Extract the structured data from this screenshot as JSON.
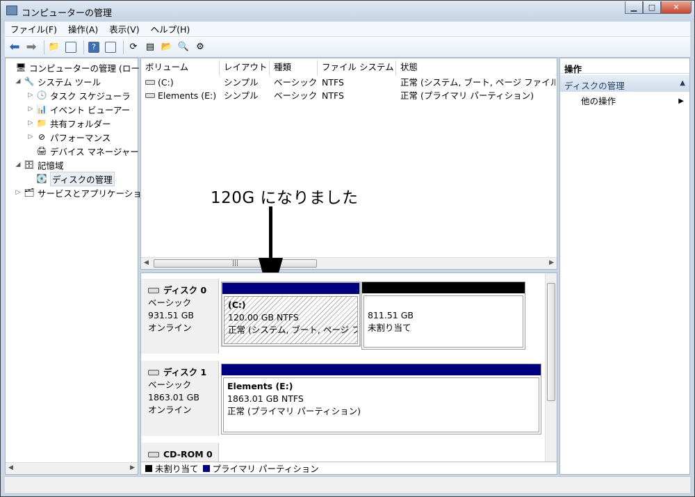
{
  "window": {
    "title": "コンピューターの管理"
  },
  "menu": [
    "ファイル(F)",
    "操作(A)",
    "表示(V)",
    "ヘルプ(H)"
  ],
  "tree": {
    "root": "コンピューターの管理 (ローカ",
    "system_tools": "システム ツール",
    "task_scheduler": "タスク スケジューラ",
    "event_viewer": "イベント ビューアー",
    "shared_folders": "共有フォルダー",
    "performance": "パフォーマンス",
    "device_manager": "デバイス マネージャー",
    "storage": "記憶域",
    "disk_management": "ディスクの管理",
    "services_apps": "サービスとアプリケーショ"
  },
  "volume_list": {
    "headers": [
      "ボリューム",
      "レイアウト",
      "種類",
      "ファイル システム",
      "状態"
    ],
    "rows": [
      [
        "(C:)",
        "シンプル",
        "ベーシック",
        "NTFS",
        "正常 (システム, ブート, ページ ファイル"
      ],
      [
        "Elements (E:)",
        "シンプル",
        "ベーシック",
        "NTFS",
        "正常 (プライマリ パーティション)"
      ]
    ]
  },
  "annotation": "120G になりました",
  "disks": [
    {
      "name": "ディスク 0",
      "type": "ベーシック",
      "size": "931.51 GB",
      "status": "オンライン",
      "partitions": [
        {
          "name": "(C:)",
          "size": "120.00 GB NTFS",
          "status": "正常 (システム, ブート, ページ フ",
          "color": "#00007f"
        },
        {
          "name": "",
          "size": "811.51 GB",
          "status": "未割り当て",
          "color": "#000000"
        }
      ]
    },
    {
      "name": "ディスク 1",
      "type": "ベーシック",
      "size": "1863.01 GB",
      "status": "オンライン",
      "partitions": [
        {
          "name": "Elements  (E:)",
          "size": "1863.01 GB NTFS",
          "status": "正常 (プライマリ パーティション)",
          "color": "#00007f"
        }
      ]
    },
    {
      "name": "CD-ROM 0"
    }
  ],
  "legend": {
    "unallocated": "未割り当て",
    "unallocated_color": "#000000",
    "primary": "プライマリ パーティション",
    "primary_color": "#00007f"
  },
  "actions": {
    "header": "操作",
    "section": "ディスクの管理",
    "more": "他の操作"
  }
}
